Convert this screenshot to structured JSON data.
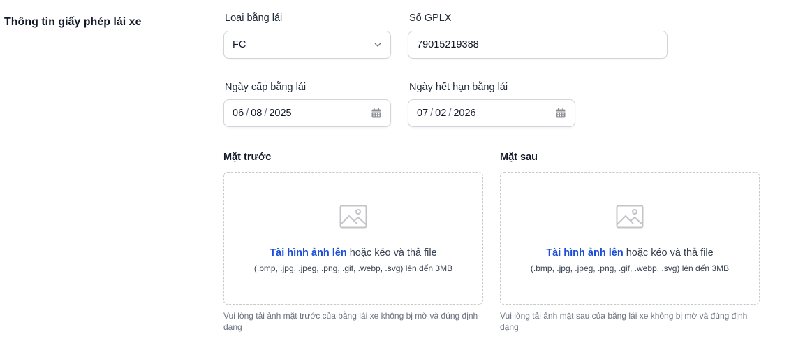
{
  "section": {
    "title": "Thông tin giấy phép lái xe"
  },
  "license_type": {
    "label": "Loại bằng lái",
    "value": "FC"
  },
  "license_number": {
    "label": "Số GPLX",
    "value": "79015219388"
  },
  "issue_date": {
    "label": "Ngày cấp bằng lái",
    "day": "06",
    "month": "08",
    "year": "2025"
  },
  "expiry_date": {
    "label": "Ngày hết hạn bằng lái",
    "day": "07",
    "month": "02",
    "year": "2026"
  },
  "front": {
    "label": "Mặt trước",
    "upload_link": "Tài hình ảnh lên",
    "upload_text": "hoặc kéo và thả file",
    "formats": "(.bmp, .jpg, .jpeg, .png, .gif, .webp, .svg) lên đến 3MB",
    "hint": "Vui lòng tải ảnh mặt trước của bằng lái xe không bị mờ và đúng định dạng"
  },
  "back": {
    "label": "Mặt sau",
    "upload_link": "Tài hình ảnh lên",
    "upload_text": "hoặc kéo và thả file",
    "formats": "(.bmp, .jpg, .jpeg, .png, .gif, .webp, .svg) lên đến 3MB",
    "hint": "Vui lòng tải ảnh mặt sau của bằng lái xe không bị mờ và đúng định dạng"
  },
  "icons": {
    "dropdown": "chevron-down-icon",
    "calendar": "calendar-icon",
    "image": "image-icon"
  }
}
